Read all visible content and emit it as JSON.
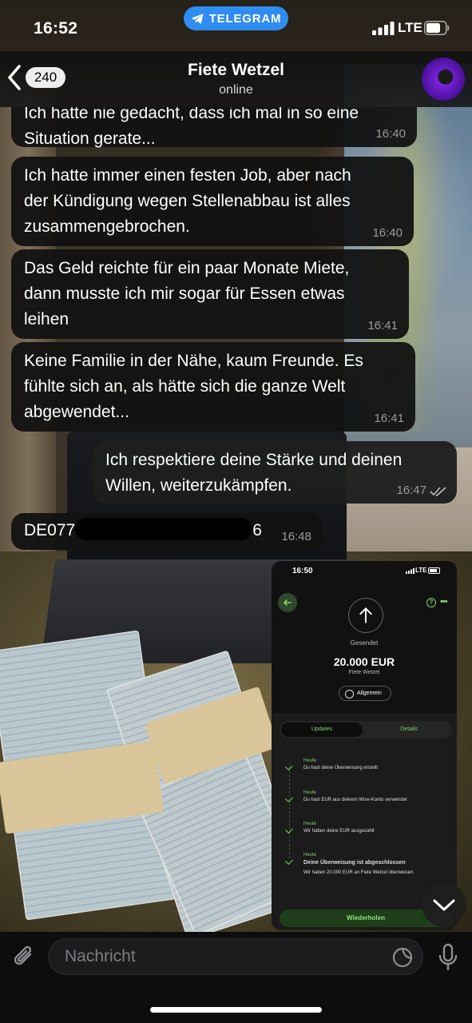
{
  "status_bar": {
    "time": "16:52",
    "pill_label": "TELEGRAM",
    "network": "LTE"
  },
  "header": {
    "back_count": "240",
    "contact_name": "Fiete Wetzel",
    "contact_status": "online"
  },
  "messages": [
    {
      "direction": "in",
      "text_lines": [
        "Ich hatte nie gedacht, dass ich mal in so eine",
        "Situation gerate..."
      ],
      "time": "16:40"
    },
    {
      "direction": "in",
      "text_lines": [
        "Ich hatte immer einen festen Job, aber nach",
        "der Kündigung wegen Stellenabbau ist alles",
        "zusammengebrochen."
      ],
      "time": "16:40"
    },
    {
      "direction": "in",
      "text_lines": [
        "Das Geld reichte für ein paar Monate Miete,",
        "dann musste ich mir sogar für Essen etwas",
        "leihen"
      ],
      "time": "16:41"
    },
    {
      "direction": "in",
      "text_lines": [
        "Keine Familie in der Nähe, kaum Freunde. Es",
        "fühlte sich an, als hätte sich die ganze Welt",
        "abgewendet..."
      ],
      "time": "16:41"
    },
    {
      "direction": "out",
      "text_lines": [
        "Ich respektiere deine Stärke und deinen",
        "Willen, weiterzukämpfen."
      ],
      "time": "16:47",
      "read": true
    },
    {
      "direction": "in",
      "iban_start": "DE077",
      "iban_end": "6",
      "time": "16:48"
    }
  ],
  "transfer_screenshot": {
    "time": "16:50",
    "network": "LTE",
    "sent_label": "Gesendet",
    "amount": "20.000 EUR",
    "recipient": "Fiete Wetzel",
    "category": "Allgemein",
    "tab_updates": "Updates",
    "tab_details": "Details",
    "steps": [
      {
        "day": "Heute",
        "text": "Du hast deine Überweisung erstellt"
      },
      {
        "day": "Heute",
        "text": "Du hast EUR aus deinem Wise-Konto verwendet"
      },
      {
        "day": "Heute",
        "text": "Wir haben deine EUR ausgezahlt"
      },
      {
        "day": "Heute",
        "text": "Deine Überweisung ist abgeschlossen",
        "sub": "Wir haben 20.000 EUR an Fiete Wetzel überwiesen."
      }
    ],
    "repeat_label": "Wiederholen",
    "accent_color": "#7fd26a"
  },
  "input": {
    "placeholder": "Nachricht"
  },
  "colors": {
    "telegram_blue": "#2f8cf0",
    "bubble_bg": "#121212"
  },
  "icons": [
    "telegram-icon",
    "signal-icon",
    "battery-icon",
    "back-chevron-icon",
    "read-receipt-icon",
    "chevron-down-icon",
    "attach-icon",
    "sticker-icon",
    "microphone-icon"
  ]
}
